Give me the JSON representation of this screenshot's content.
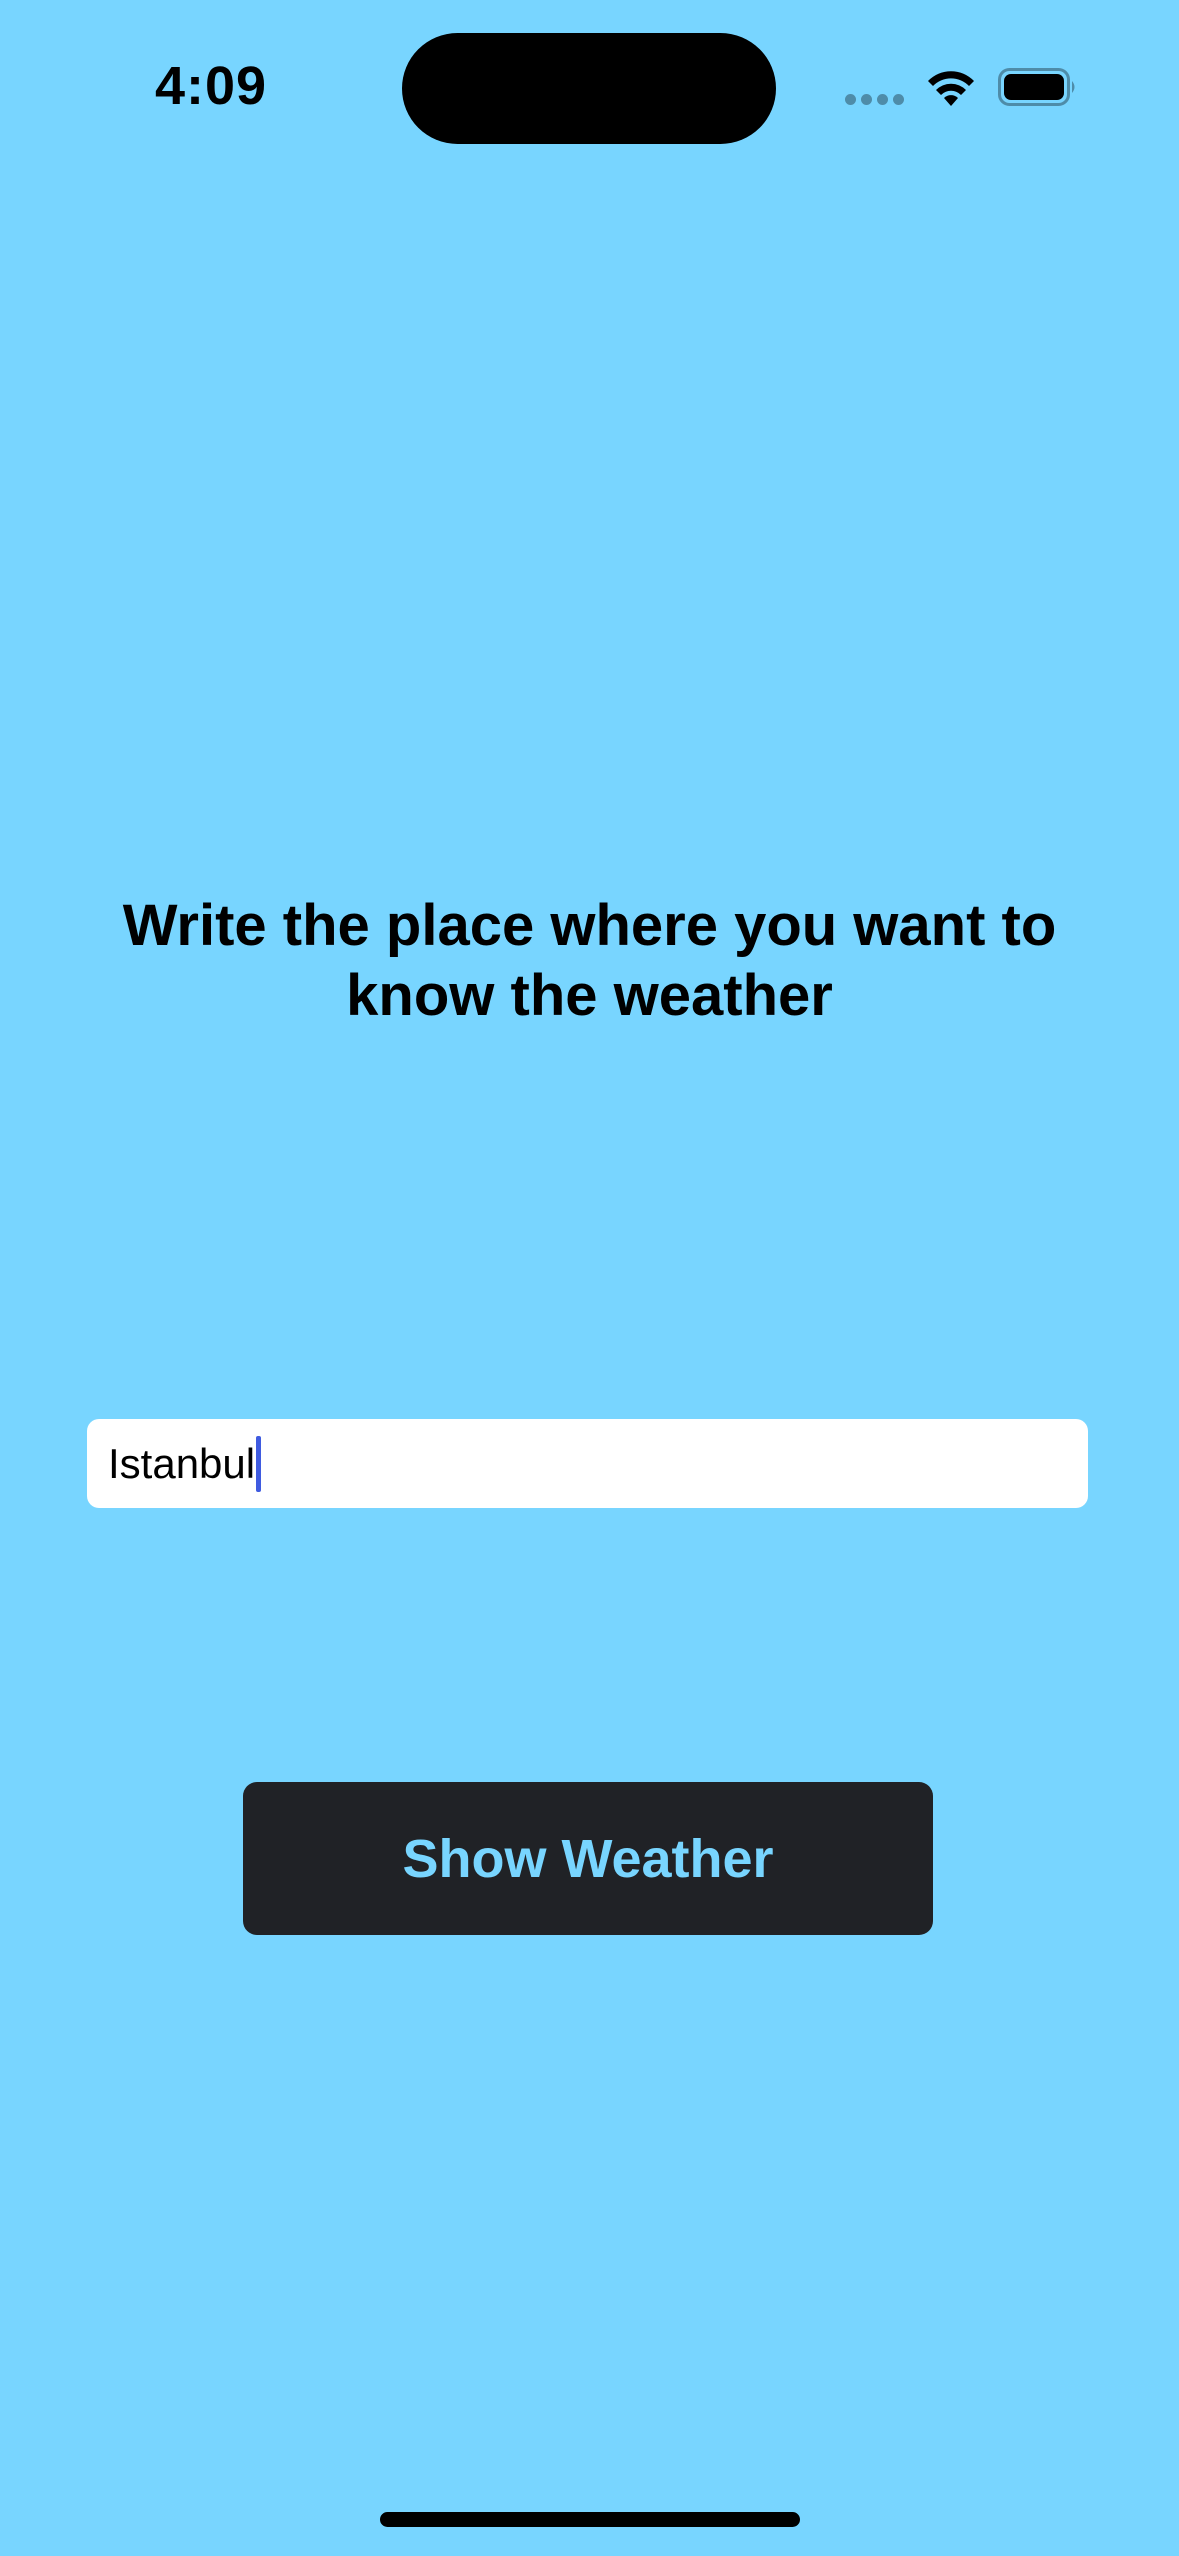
{
  "status_bar": {
    "time": "4:09",
    "signal_icon": "cellular-signal-icon",
    "wifi_icon": "wifi-icon",
    "battery_icon": "battery-icon",
    "battery_level": 1.0
  },
  "main": {
    "headline": "Write the place where you want to know the weather",
    "location_input": {
      "value": "Istanbul",
      "placeholder": ""
    },
    "show_button_label": "Show Weather"
  },
  "colors": {
    "background": "#78D5FF",
    "button_background": "#202226",
    "button_text": "#78D5FF",
    "caret": "#3F5BE0"
  }
}
